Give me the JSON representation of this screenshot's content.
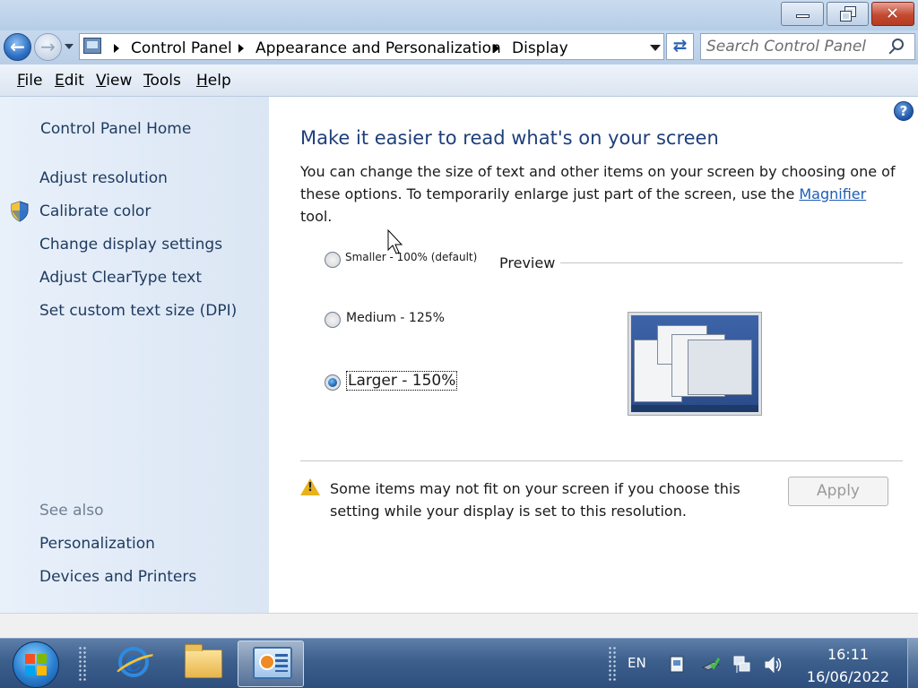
{
  "window": {
    "caption_buttons": {
      "minimize": "minimize",
      "maximize": "restore",
      "close": "close"
    }
  },
  "navigation": {
    "breadcrumbs": [
      "Control Panel",
      "Appearance and Personalization",
      "Display"
    ],
    "search_placeholder": "Search Control Panel"
  },
  "menu": {
    "items": [
      {
        "label": "File",
        "accel": "F"
      },
      {
        "label": "Edit",
        "accel": "E"
      },
      {
        "label": "View",
        "accel": "V"
      },
      {
        "label": "Tools",
        "accel": "T"
      },
      {
        "label": "Help",
        "accel": "H"
      }
    ]
  },
  "sidebar": {
    "home": "Control Panel Home",
    "tasks": [
      "Adjust resolution",
      "Calibrate color",
      "Change display settings",
      "Adjust ClearType text",
      "Set custom text size (DPI)"
    ],
    "see_also_title": "See also",
    "see_also": [
      "Personalization",
      "Devices and Printers"
    ]
  },
  "main": {
    "heading": "Make it easier to read what's on your screen",
    "description_before": "You can change the size of text and other items on your screen by choosing one of these options. To temporarily enlarge just part of the screen, use the ",
    "magnifier_link": "Magnifier",
    "description_after": " tool.",
    "options": [
      {
        "label": "Smaller - 100% (default)",
        "checked": false
      },
      {
        "label": "Medium - 125%",
        "checked": false
      },
      {
        "label": "Larger - 150%",
        "checked": true
      }
    ],
    "preview_label": "Preview",
    "warning": "Some items may not fit on your screen if you choose this setting while your display is set to this resolution.",
    "apply_label": "Apply",
    "apply_enabled": false
  },
  "taskbar": {
    "pinned": [
      "internet-explorer",
      "windows-explorer",
      "control-panel"
    ],
    "active": "control-panel",
    "language": "EN",
    "time": "16:11",
    "date": "16/06/2022"
  },
  "colors": {
    "heading": "#1e3f7a",
    "link": "#1d5db7",
    "sidebar_text": "#1e3a5f",
    "taskbar": "#3d5f8c"
  }
}
